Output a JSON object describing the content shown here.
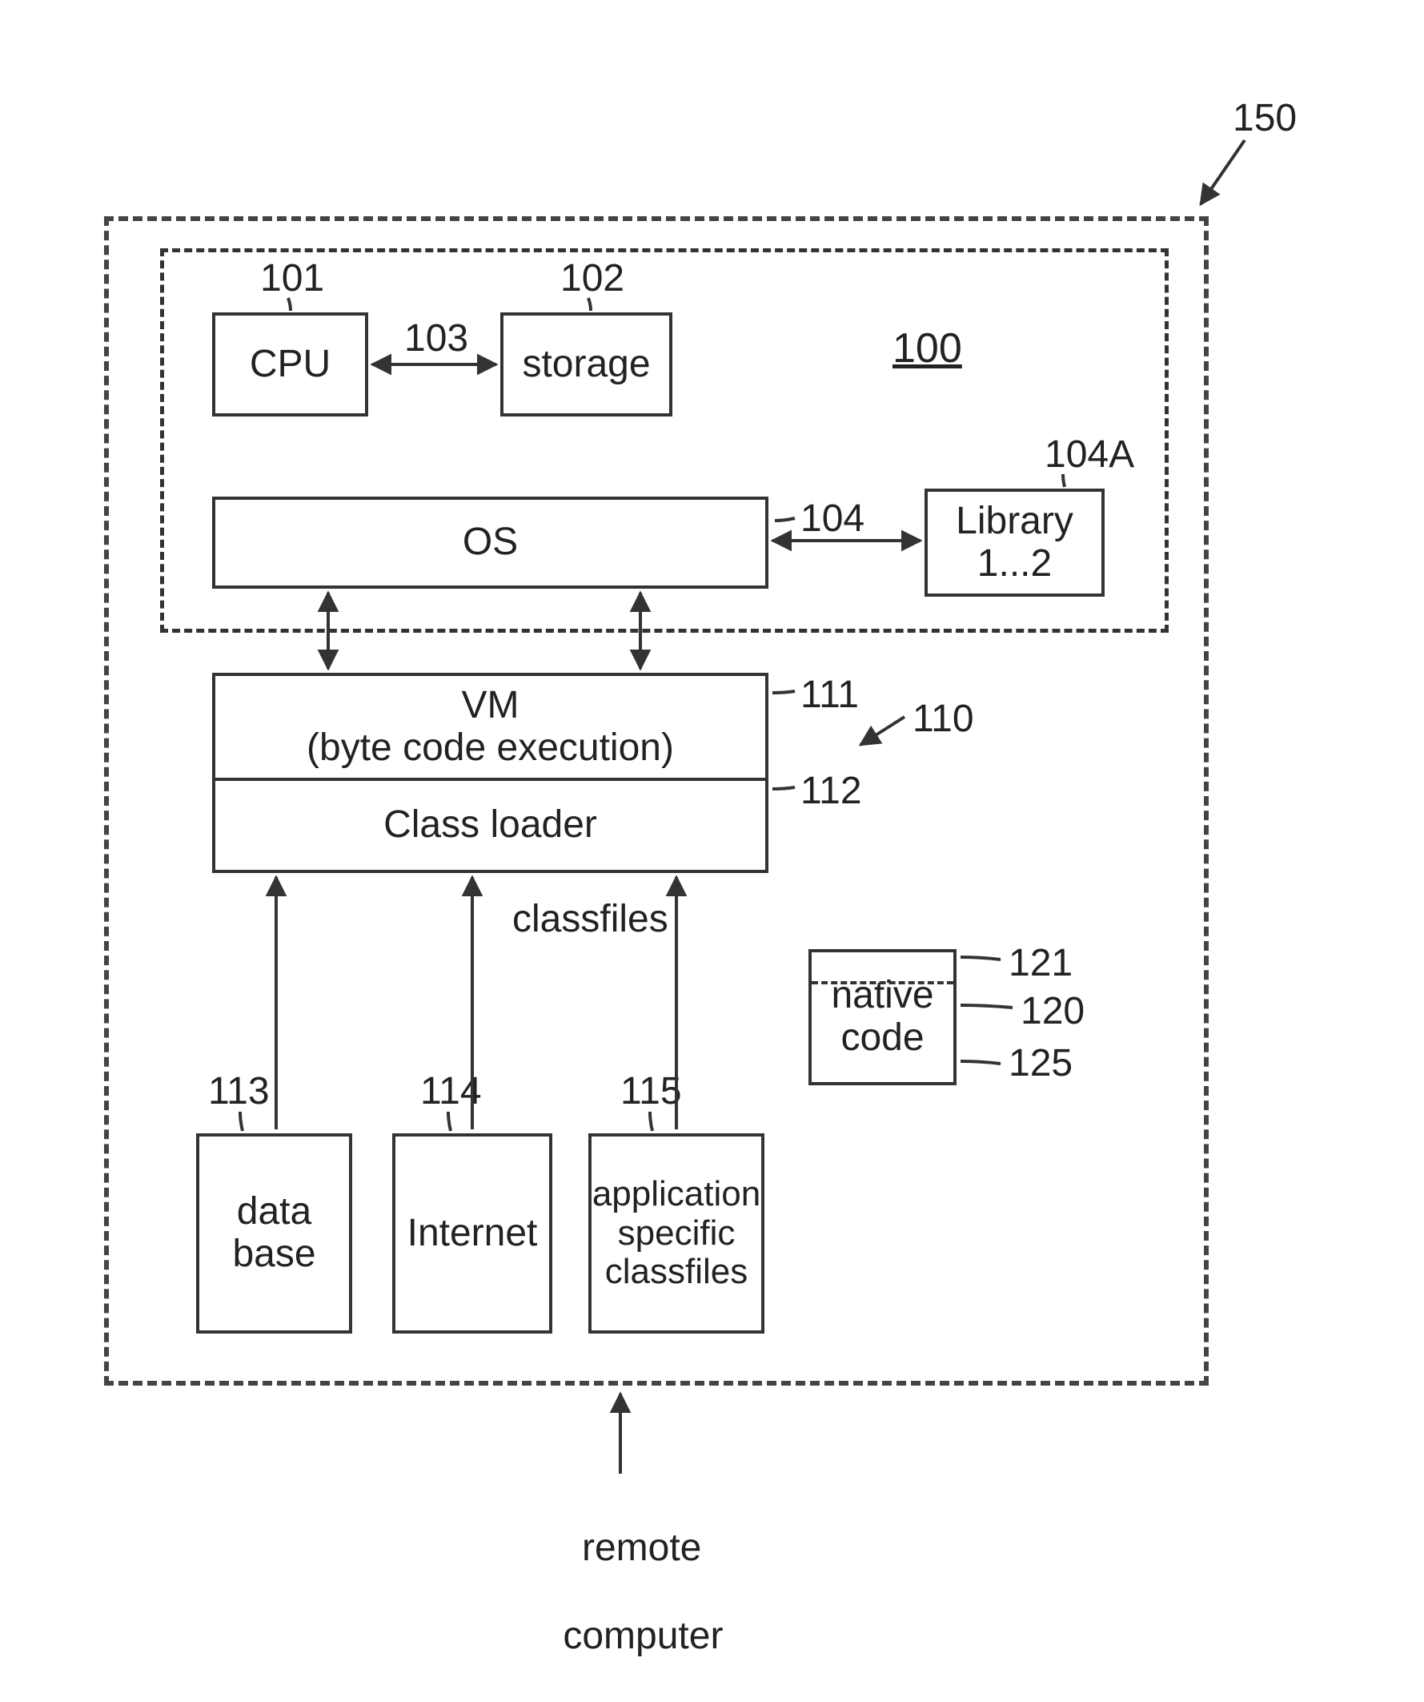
{
  "refs": {
    "outer": "150",
    "hw": "100",
    "cpu_ref": "101",
    "storage_ref": "102",
    "bus_ref": "103",
    "os_ref": "104",
    "lib_ref": "104A",
    "vm_ref": "111",
    "vm_group_ref": "110",
    "classloader_ref": "112",
    "db_ref": "113",
    "net_ref": "114",
    "app_ref": "115",
    "nc_top_ref": "121",
    "nc_mid_ref": "120",
    "nc_bot_ref": "125"
  },
  "boxes": {
    "cpu": "CPU",
    "storage": "storage",
    "os": "OS",
    "library_l1": "Library",
    "library_l2": "1...2",
    "vm_l1": "VM",
    "vm_l2": "(byte code execution)",
    "classloader": "Class loader",
    "classfiles": "classfiles",
    "native_code_l1": "native",
    "native_code_l2": "code",
    "database_l1": "data",
    "database_l2": "base",
    "internet": "Internet",
    "appfiles_l1": "application",
    "appfiles_l2": "specific",
    "appfiles_l3": "classfiles"
  },
  "external": {
    "remote_l1": "remote",
    "remote_l2": "computer"
  }
}
